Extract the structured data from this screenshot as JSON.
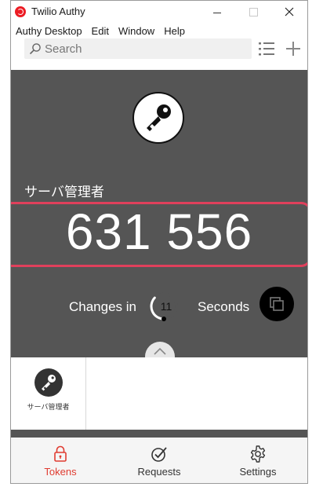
{
  "window": {
    "title": "Twilio Authy"
  },
  "menubar": {
    "items": [
      "Authy Desktop",
      "Edit",
      "Window",
      "Help"
    ]
  },
  "search": {
    "placeholder": "Search",
    "value": ""
  },
  "token": {
    "name": "サーバ管理者",
    "code": "631 556",
    "changes_in_label": "Changes in",
    "countdown_seconds": "11",
    "seconds_label": "Seconds",
    "countdown_remaining_fraction": 0.37
  },
  "token_list": [
    {
      "label": "サーバ管理者",
      "icon": "key-icon"
    }
  ],
  "bottom_nav": {
    "tabs": [
      {
        "label": "Tokens",
        "icon": "lock-icon",
        "active": true
      },
      {
        "label": "Requests",
        "icon": "check-circle-icon",
        "active": false
      },
      {
        "label": "Settings",
        "icon": "gear-icon",
        "active": false
      }
    ]
  },
  "colors": {
    "brand_red": "#ec1c24",
    "active_tab": "#e03c31",
    "highlight_border": "#e0405c",
    "panel_bg": "#555555"
  }
}
